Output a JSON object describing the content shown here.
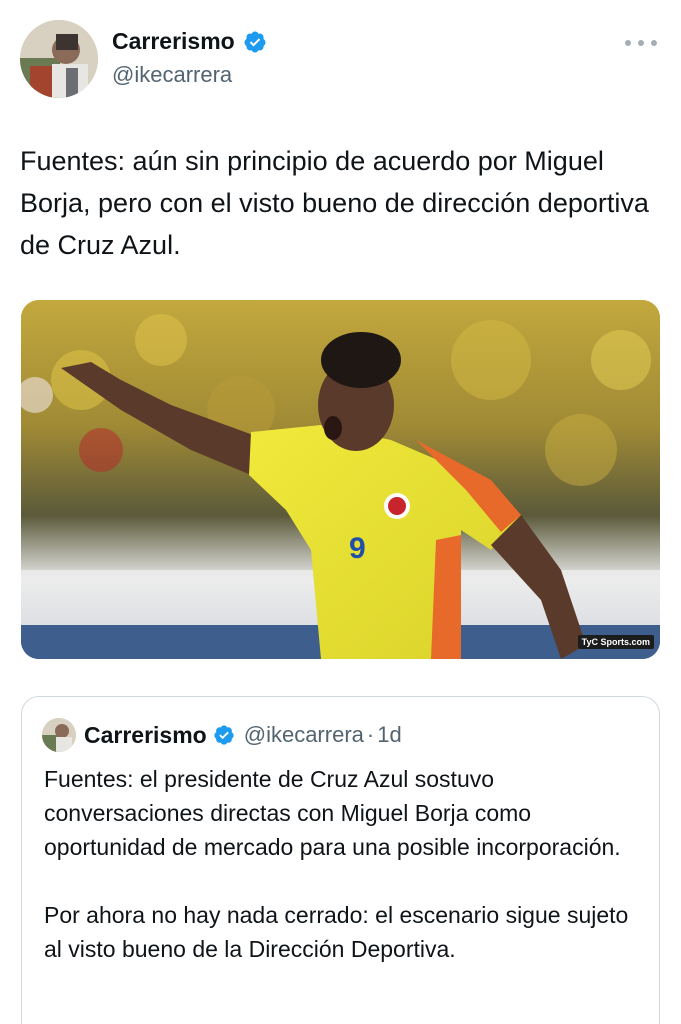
{
  "author": {
    "display_name": "Carrerismo",
    "handle": "@ikecarrera",
    "verified": true,
    "verified_color": "#1d9bf0"
  },
  "icons": {
    "more": "more-horizontal-icon",
    "verified": "verified-badge-icon"
  },
  "tweet": {
    "text": "Fuentes: aún sin principio de acuerdo por Miguel Borja, pero con el visto bueno de dirección deportiva de Cruz Azul."
  },
  "media": {
    "watermark": "TyC Sports.com",
    "jersey_number": "9"
  },
  "quoted": {
    "display_name": "Carrerismo",
    "handle": "@ikecarrera",
    "separator": "·",
    "time": "1d",
    "paragraph_1": "Fuentes: el presidente de Cruz Azul sostuvo conversaciones directas con Miguel Borja como oportunidad de mercado para una posible incorporación.",
    "paragraph_2": "Por ahora no hay nada cerrado: el escenario sigue sujeto al visto bueno de la Dirección Deportiva."
  }
}
